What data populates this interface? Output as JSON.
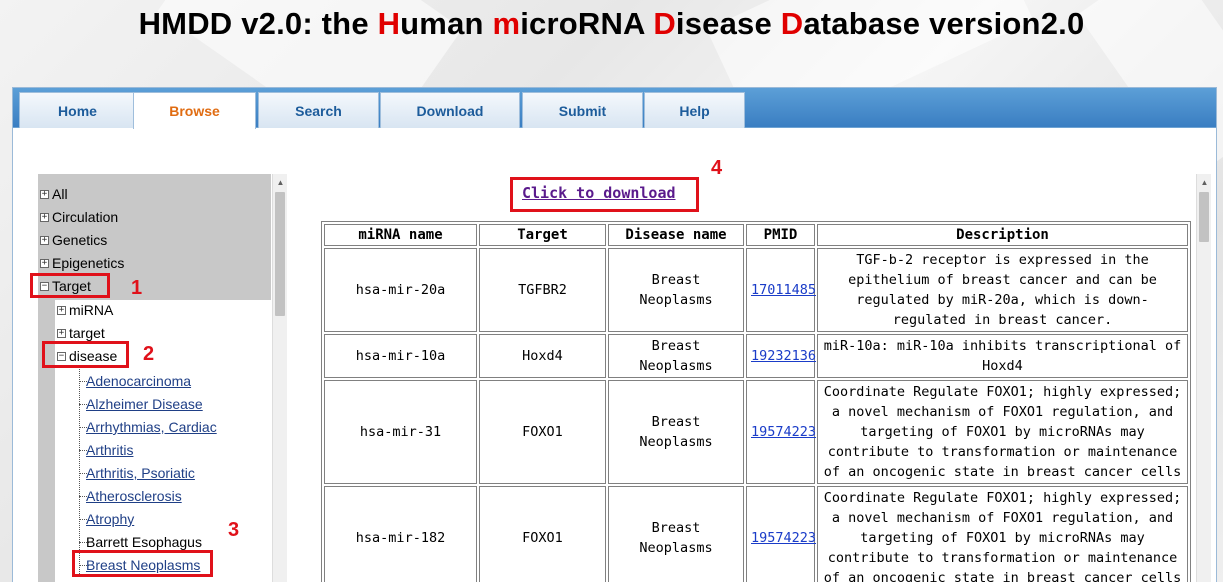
{
  "title": {
    "prefix": "HMDD v2.0: the ",
    "h": "H",
    "uman": "uman ",
    "m": "m",
    "icro": "icroRNA ",
    "d1": "D",
    "isease": "isease ",
    "d2": "D",
    "atabase": "atabase version2.0"
  },
  "nav": {
    "tabs": [
      "Home",
      "Browse",
      "Search",
      "Download",
      "Submit",
      "Help"
    ],
    "active": "Browse"
  },
  "tree": {
    "top": [
      "All",
      "Circulation",
      "Genetics",
      "Epigenetics",
      "Target"
    ],
    "target_children": [
      "miRNA",
      "target",
      "disease"
    ],
    "disease_children": [
      "Adenocarcinoma",
      "Alzheimer Disease",
      "Arrhythmias, Cardiac",
      "Arthritis",
      "Arthritis, Psoriatic",
      "Atherosclerosis",
      "Atrophy",
      "Barrett Esophagus",
      "Breast Neoplasms"
    ],
    "expand_collapsed": "+",
    "expand_open": "−"
  },
  "annotations": [
    "1",
    "2",
    "3",
    "4"
  ],
  "download": {
    "label": "Click to download"
  },
  "table": {
    "headers": [
      "miRNA name",
      "Target",
      "Disease name",
      "PMID",
      "Description"
    ],
    "rows": [
      {
        "mirna": "hsa-mir-20a",
        "target": "TGFBR2",
        "disease": "Breast Neoplasms",
        "pmid": "17011485",
        "description": "TGF-b-2 receptor is expressed in the epithelium of breast cancer and can be regulated by miR-20a, which is down-regulated in breast cancer."
      },
      {
        "mirna": "hsa-mir-10a",
        "target": "Hoxd4",
        "disease": "Breast Neoplasms",
        "pmid": "19232136",
        "description": "miR-10a: miR-10a inhibits transcriptional of Hoxd4"
      },
      {
        "mirna": "hsa-mir-31",
        "target": "FOXO1",
        "disease": "Breast Neoplasms",
        "pmid": "19574223",
        "description": "Coordinate Regulate FOXO1; highly expressed; a novel mechanism of FOXO1 regulation, and targeting of FOXO1 by microRNAs may contribute to transformation or maintenance of an oncogenic state in breast cancer cells"
      },
      {
        "mirna": "hsa-mir-182",
        "target": "FOXO1",
        "disease": "Breast Neoplasms",
        "pmid": "19574223",
        "description": "Coordinate Regulate FOXO1; highly expressed; a novel mechanism of FOXO1 regulation, and targeting of FOXO1 by microRNAs may contribute to transformation or maintenance of an oncogenic state in breast cancer cells"
      }
    ]
  },
  "colors": {
    "annotation": "#e0111a",
    "active_tab": "#e06c12",
    "nav": "#3a7ec2"
  }
}
